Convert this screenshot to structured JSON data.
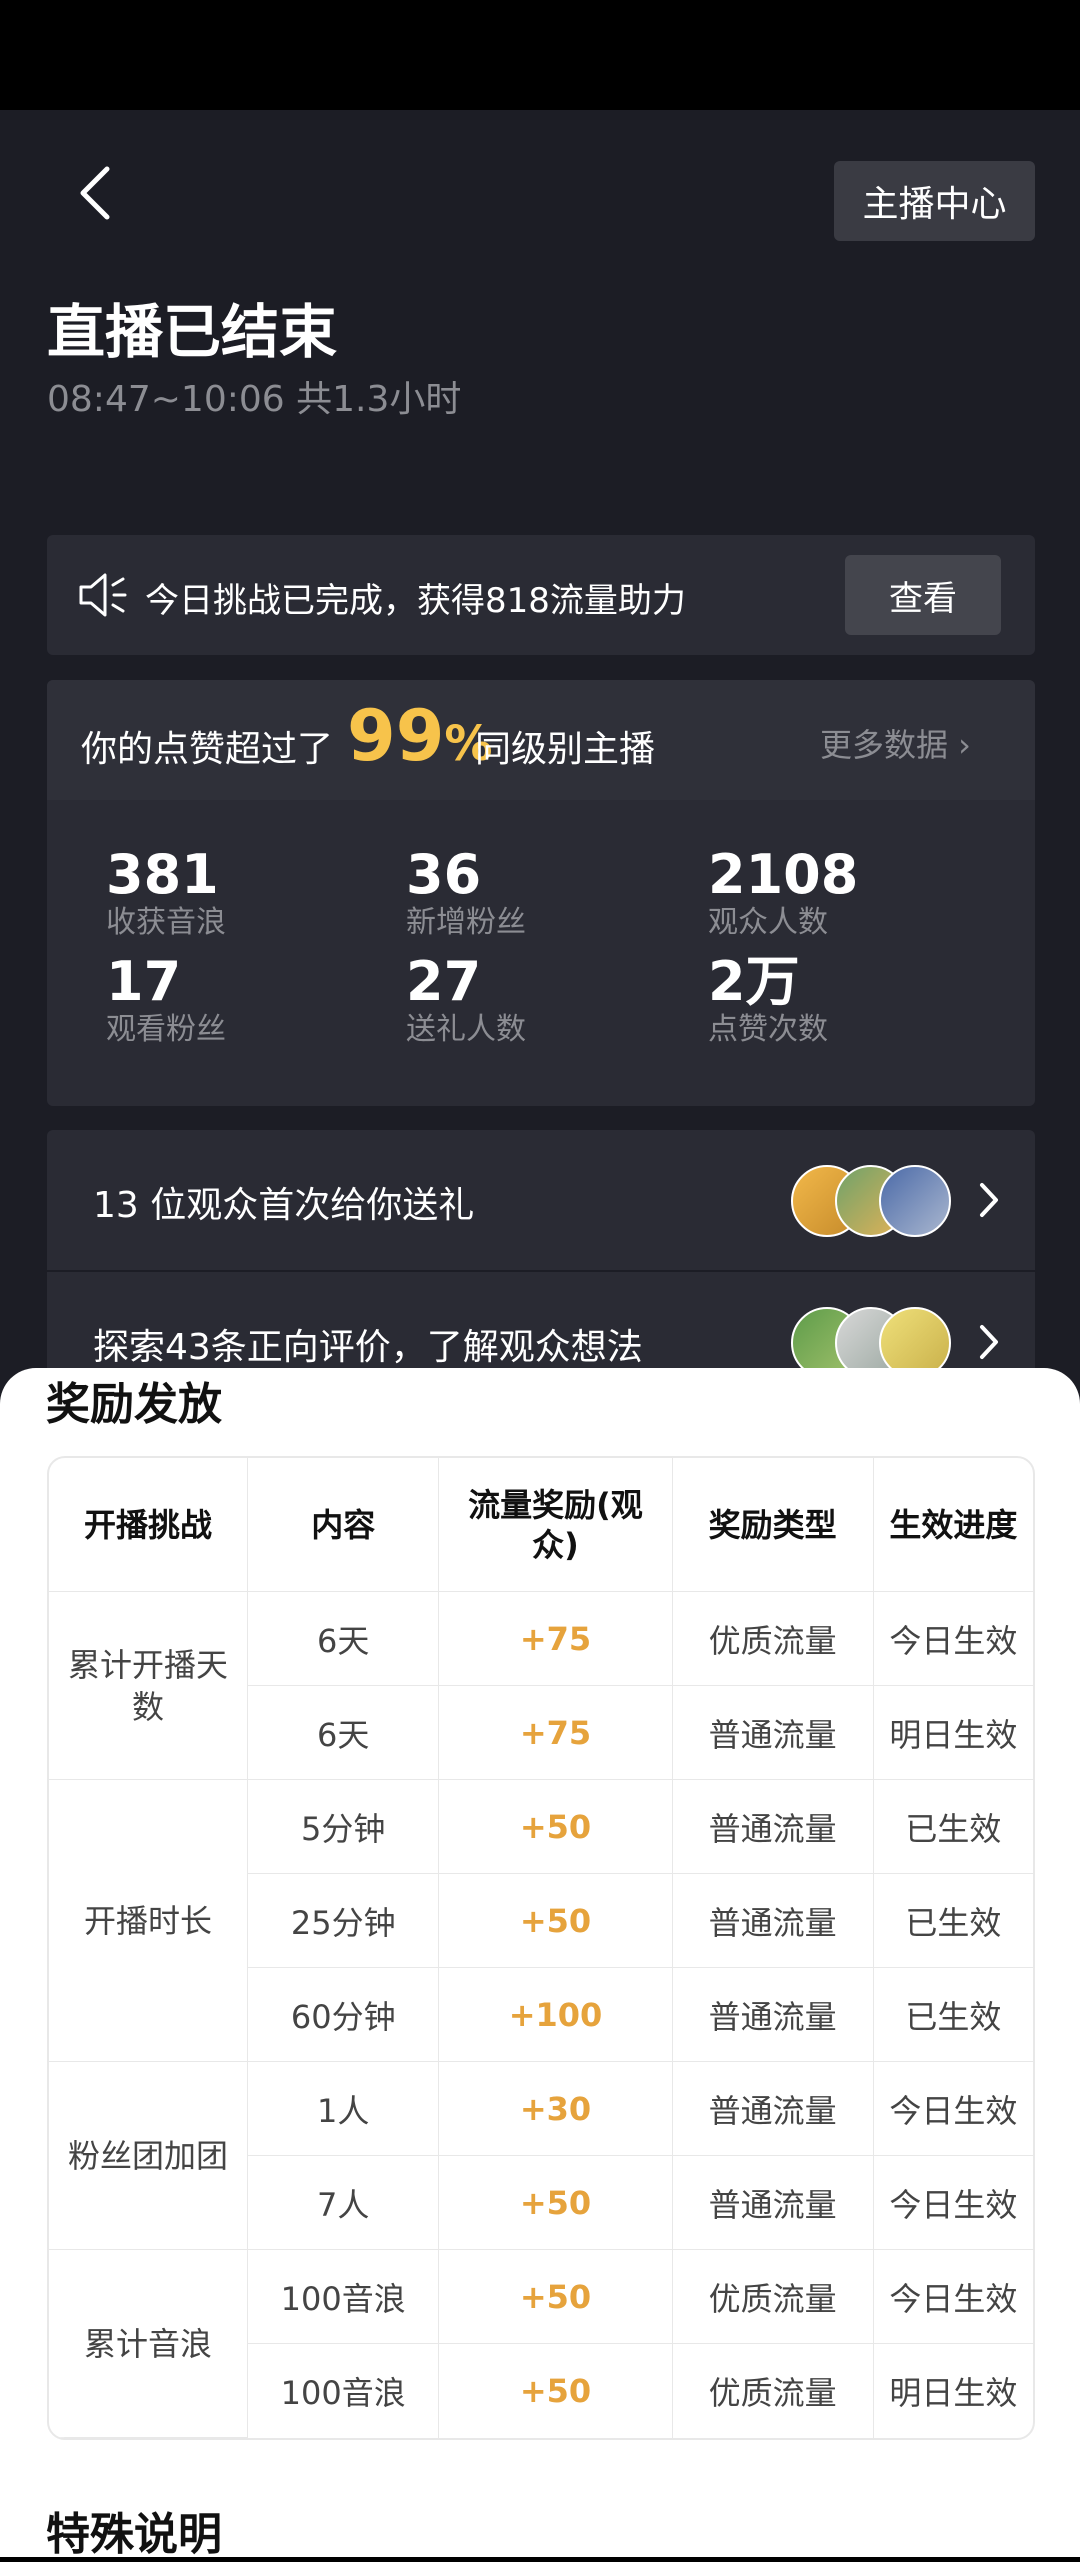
{
  "header": {
    "host_center_label": "主播中心",
    "title": "直播已结束",
    "time_range": "08:47~10:06 共1.3小时"
  },
  "challenge": {
    "text": "今日挑战已完成，获得818流量助力",
    "view_label": "查看"
  },
  "stats": {
    "prefix": "你的点赞超过了",
    "percent": "99",
    "percent_sign": "%",
    "suffix": "同级别主播",
    "more_label": "更多数据 ›",
    "items": [
      {
        "value": "381",
        "label": "收获音浪"
      },
      {
        "value": "36",
        "label": "新增粉丝"
      },
      {
        "value": "2108",
        "label": "观众人数"
      },
      {
        "value": "17",
        "label": "观看粉丝"
      },
      {
        "value": "27",
        "label": "送礼人数"
      },
      {
        "value": "2万",
        "label": "点赞次数"
      }
    ]
  },
  "cards": [
    {
      "text": "13 位观众首次给你送礼"
    },
    {
      "text": "探索43条正向评价，了解观众想法"
    }
  ],
  "reward": {
    "section_title": "奖励发放",
    "headers": [
      "开播挑战",
      "内容",
      "流量奖励(观众)",
      "奖励类型",
      "生效进度"
    ],
    "groups": [
      "累计开播天数",
      "开播时长",
      "粉丝团加团",
      "累计音浪"
    ],
    "rows": [
      {
        "content": "6天",
        "flow": "+75",
        "type": "优质流量",
        "status": "今日生效"
      },
      {
        "content": "6天",
        "flow": "+75",
        "type": "普通流量",
        "status": "明日生效"
      },
      {
        "content": "5分钟",
        "flow": "+50",
        "type": "普通流量",
        "status": "已生效"
      },
      {
        "content": "25分钟",
        "flow": "+50",
        "type": "普通流量",
        "status": "已生效"
      },
      {
        "content": "60分钟",
        "flow": "+100",
        "type": "普通流量",
        "status": "已生效"
      },
      {
        "content": "1人",
        "flow": "+30",
        "type": "普通流量",
        "status": "今日生效"
      },
      {
        "content": "7人",
        "flow": "+50",
        "type": "普通流量",
        "status": "今日生效"
      },
      {
        "content": "100音浪",
        "flow": "+50",
        "type": "优质流量",
        "status": "今日生效"
      },
      {
        "content": "100音浪",
        "flow": "+50",
        "type": "优质流量",
        "status": "明日生效"
      }
    ]
  },
  "special_title": "特殊说明",
  "colors": {
    "accent": "#f7c34b",
    "flow": "#e6a33c",
    "dark_bg": "#1c1d25",
    "card_bg": "#2a2b34"
  }
}
